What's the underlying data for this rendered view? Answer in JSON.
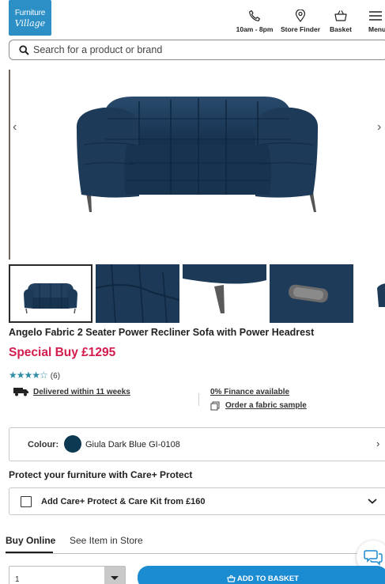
{
  "header": {
    "logo_line1": "Furniture",
    "logo_line2": "Village",
    "hours": "10am - 8pm",
    "store_finder": "Store Finder",
    "basket": "Basket",
    "menu": "Menu"
  },
  "search": {
    "placeholder": "Search for a product or brand"
  },
  "gallery": {
    "prev": "‹",
    "next": "›",
    "thumbnail_count": 5,
    "active_index": 0
  },
  "product": {
    "title": "Angelo Fabric 2 Seater Power Recliner Sofa with Power Headrest",
    "price": "Special Buy £1295",
    "stars": "★★★★☆",
    "rating_value": 4.5,
    "review_count": "(6)",
    "delivery": "Delivered within 11 weeks",
    "finance": "0% Finance available",
    "fabric_sample": "Order a fabric sample"
  },
  "colour": {
    "label": "Colour:",
    "value": "Giula Dark Blue GI-0108",
    "swatch_color": "#0d3a52"
  },
  "care": {
    "heading": "Protect your furniture with Care+ Protect",
    "option_label": "Add Care+ Protect & Care Kit from £160"
  },
  "tabs": [
    "Buy Online",
    "See Item in Store"
  ],
  "purchase": {
    "quantity": "1",
    "add_button": "ADD TO BASKET"
  },
  "colors": {
    "accent": "#1b8bd2",
    "price": "#d31b4d",
    "star": "#2e8ca3",
    "sofa": "#1f3d5c"
  }
}
